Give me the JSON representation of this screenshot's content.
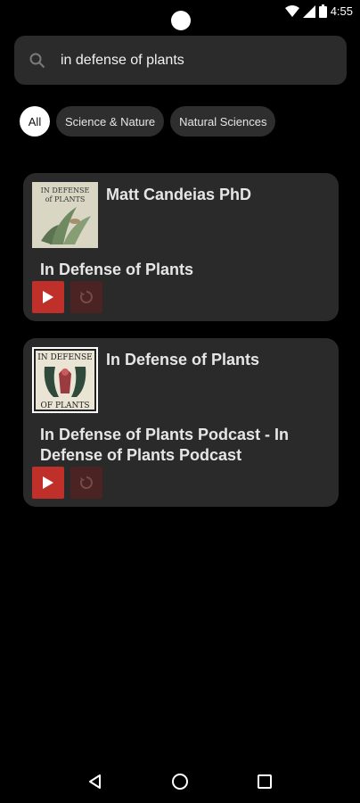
{
  "status": {
    "time": "4:55"
  },
  "search": {
    "query": "in defense of plants"
  },
  "chips": [
    "All",
    "Science & Nature",
    "Natural Sciences"
  ],
  "results": [
    {
      "author": "Matt Candeias PhD",
      "title": "In Defense of Plants"
    },
    {
      "author": "In Defense of Plants",
      "title": "In Defense of Plants Podcast - In Defense of Plants Podcast"
    }
  ],
  "colors": {
    "accent": "#c0302a",
    "card": "#2a2a2a",
    "background": "#000000"
  }
}
